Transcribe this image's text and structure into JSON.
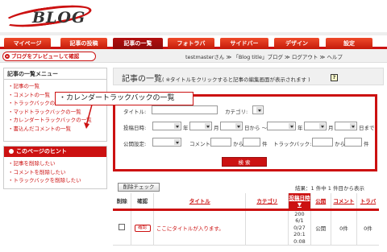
{
  "logo": {
    "text": "BLOG"
  },
  "nav": {
    "tabs": [
      {
        "label": "マイページ",
        "active": false
      },
      {
        "label": "記事の投稿",
        "active": false
      },
      {
        "label": "記事の一覧",
        "active": true
      },
      {
        "label": "フォトラバ",
        "active": false
      },
      {
        "label": "サイドバー",
        "active": false
      },
      {
        "label": "デザイン",
        "active": false
      },
      {
        "label": "設定",
        "active": false
      }
    ]
  },
  "subbar": {
    "preview_label": "ブログをプレビューして確認",
    "user_info": "testmasterさん ≫ 「Blog title」ブログ ≫ ログアウト ≫ ヘルプ"
  },
  "sidebar": {
    "menu_title": "記事の一覧メニュー",
    "menu_items": [
      "・記事の一覧",
      "・コメントの一覧",
      "・トラックバックの一覧",
      "・マッドトラックバックの一覧",
      "・カレンダートラックバックの一覧",
      "・書込んだコメントの一覧"
    ],
    "hint_title": "このページのヒント",
    "hint_items": [
      "・記事を削除したい",
      "・コメントを削除したい",
      "・トラックバックを削除したい"
    ]
  },
  "callout": {
    "text": "・カレンダートラックバックの一覧"
  },
  "main": {
    "heading": "記事の一覧",
    "heading_note": "( ※タイトルをクリックすると記事の編集画面が表示されます )",
    "help_icon_label": "?",
    "search": {
      "title_label": "タイトル:",
      "category_label": "カテゴリ:",
      "date_label": "投稿日時:",
      "year": "年",
      "month": "月",
      "day_from": "日から ～",
      "day_to": "日まで",
      "public_label": "公開設定:",
      "comment_label": "コメント:",
      "from": "から",
      "count": "件",
      "trackback_label": "トラックバック:",
      "button": "検 索"
    },
    "delete_check_label": "削除チェック",
    "result_summary": "結果：1 件中 1 件目から表示",
    "table": {
      "headers": [
        "削除",
        "確認",
        "タイトル",
        "カテゴリ",
        "投稿日時▼",
        "公開",
        "コメント",
        "トラバ"
      ],
      "rows": [
        {
          "confirm": "確認",
          "title": "ここにタイトルが入ります。",
          "category": "",
          "date_lines": [
            "200",
            "6/1",
            "0/27",
            "20:1",
            "0:08"
          ],
          "public": "公開",
          "comments": "0件",
          "trackbacks": "0件"
        }
      ]
    }
  },
  "colors": {
    "brand": "#cc1111",
    "panel": "#f0f0f0"
  }
}
